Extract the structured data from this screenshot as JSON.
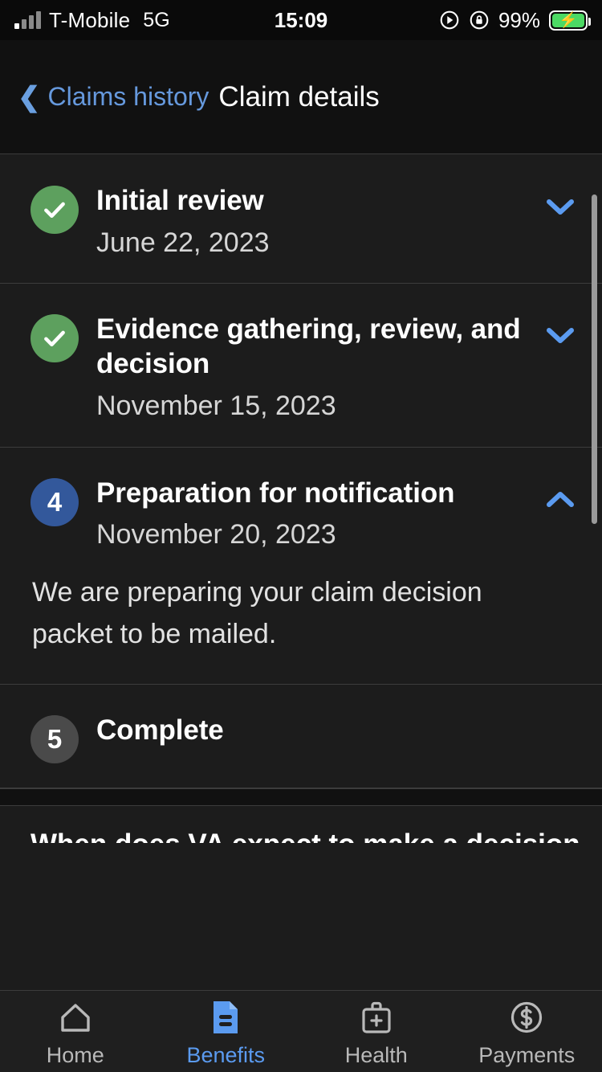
{
  "status_bar": {
    "carrier": "T-Mobile",
    "network": "5G",
    "time": "15:09",
    "battery_percent": "99%",
    "icons": [
      "signal-bars-icon",
      "location-arrow-icon",
      "rotation-lock-icon",
      "battery-charging-icon"
    ]
  },
  "header": {
    "back_label": "Claims history",
    "back_icon": "chevron-left-icon",
    "title": "Claim details"
  },
  "timeline": {
    "steps": [
      {
        "marker": "check",
        "marker_icon": "check-circle-icon",
        "title": "Initial review",
        "date": "June 22, 2023",
        "expanded": false,
        "caret_icon": "chevron-down-icon",
        "body": ""
      },
      {
        "marker": "check",
        "marker_icon": "check-circle-icon",
        "title": "Evidence gathering, review, and decision",
        "date": "November 15, 2023",
        "expanded": false,
        "caret_icon": "chevron-down-icon",
        "body": ""
      },
      {
        "marker": "4",
        "marker_icon": "step-number-circle",
        "title": "Preparation for notification",
        "date": "November 20, 2023",
        "expanded": true,
        "caret_icon": "chevron-up-icon",
        "body": "We are preparing your claim decision packet to be mailed."
      },
      {
        "marker": "5",
        "marker_icon": "step-number-circle",
        "title": "Complete",
        "date": "",
        "expanded": false,
        "caret_icon": "",
        "body": ""
      }
    ]
  },
  "next_section": {
    "heading": "When does VA expect to make a decision"
  },
  "tabs": [
    {
      "label": "Home",
      "icon": "home-icon",
      "active": false
    },
    {
      "label": "Benefits",
      "icon": "document-icon",
      "active": true
    },
    {
      "label": "Health",
      "icon": "medical-bag-icon",
      "active": false
    },
    {
      "label": "Payments",
      "icon": "dollar-circle-icon",
      "active": false
    }
  ],
  "colors": {
    "accent_blue": "#5b9bf0",
    "link_blue": "#6699dd",
    "success_green": "#5da05e",
    "active_step_blue": "#33589b",
    "inactive_gray": "#4a4a4a",
    "background": "#1c1c1c",
    "battery_green": "#4cd964"
  }
}
